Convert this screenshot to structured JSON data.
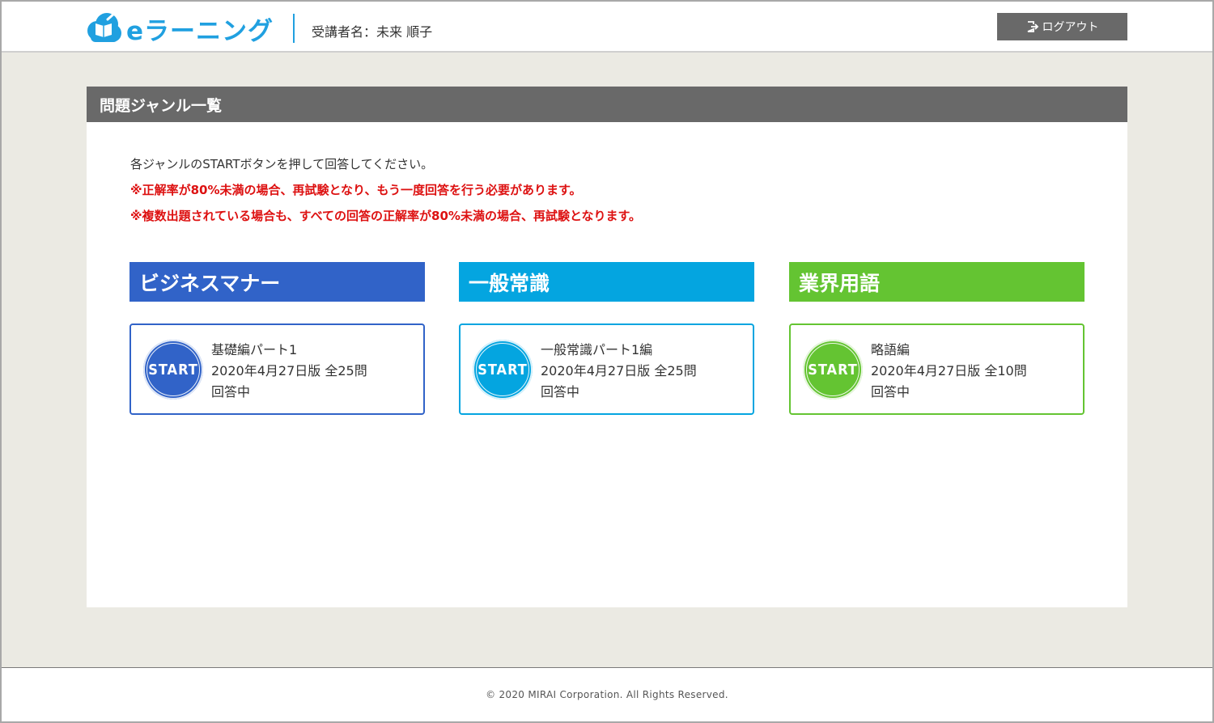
{
  "header": {
    "app_name": "eラーニング",
    "learner_label": "受講者名：未来 順子",
    "logout_label": "ログアウト"
  },
  "panel": {
    "title": "問題ジャンル一覧",
    "instruction": "各ジャンルのSTARTボタンを押して回答してください。",
    "warning_1": "※正解率が80%未満の場合、再試験となり、もう一度回答を行う必要があります。",
    "warning_2": "※複数出題されている場合も、すべての回答の正解率が80%未満の場合、再試験となります。"
  },
  "genres": [
    {
      "name": "ビジネスマナー",
      "color": "#3163c8",
      "start_label": "START",
      "course_title": "基礎編パート1",
      "course_version": "2020年4月27日版 全25問",
      "status": "回答中"
    },
    {
      "name": "一般常識",
      "color": "#04a5e0",
      "start_label": "START",
      "course_title": "一般常識パート1編",
      "course_version": "2020年4月27日版 全25問",
      "status": "回答中"
    },
    {
      "name": "業界用語",
      "color": "#64c432",
      "start_label": "START",
      "course_title": "略語編",
      "course_version": "2020年4月27日版 全10問",
      "status": "回答中"
    }
  ],
  "footer": {
    "copyright": "© 2020 MIRAI Corporation. All Rights Reserved."
  },
  "colors": {
    "brand": "#20a0e0",
    "warning": "#dd1111",
    "panel_header": "#696969",
    "background": "#ebeae3"
  }
}
